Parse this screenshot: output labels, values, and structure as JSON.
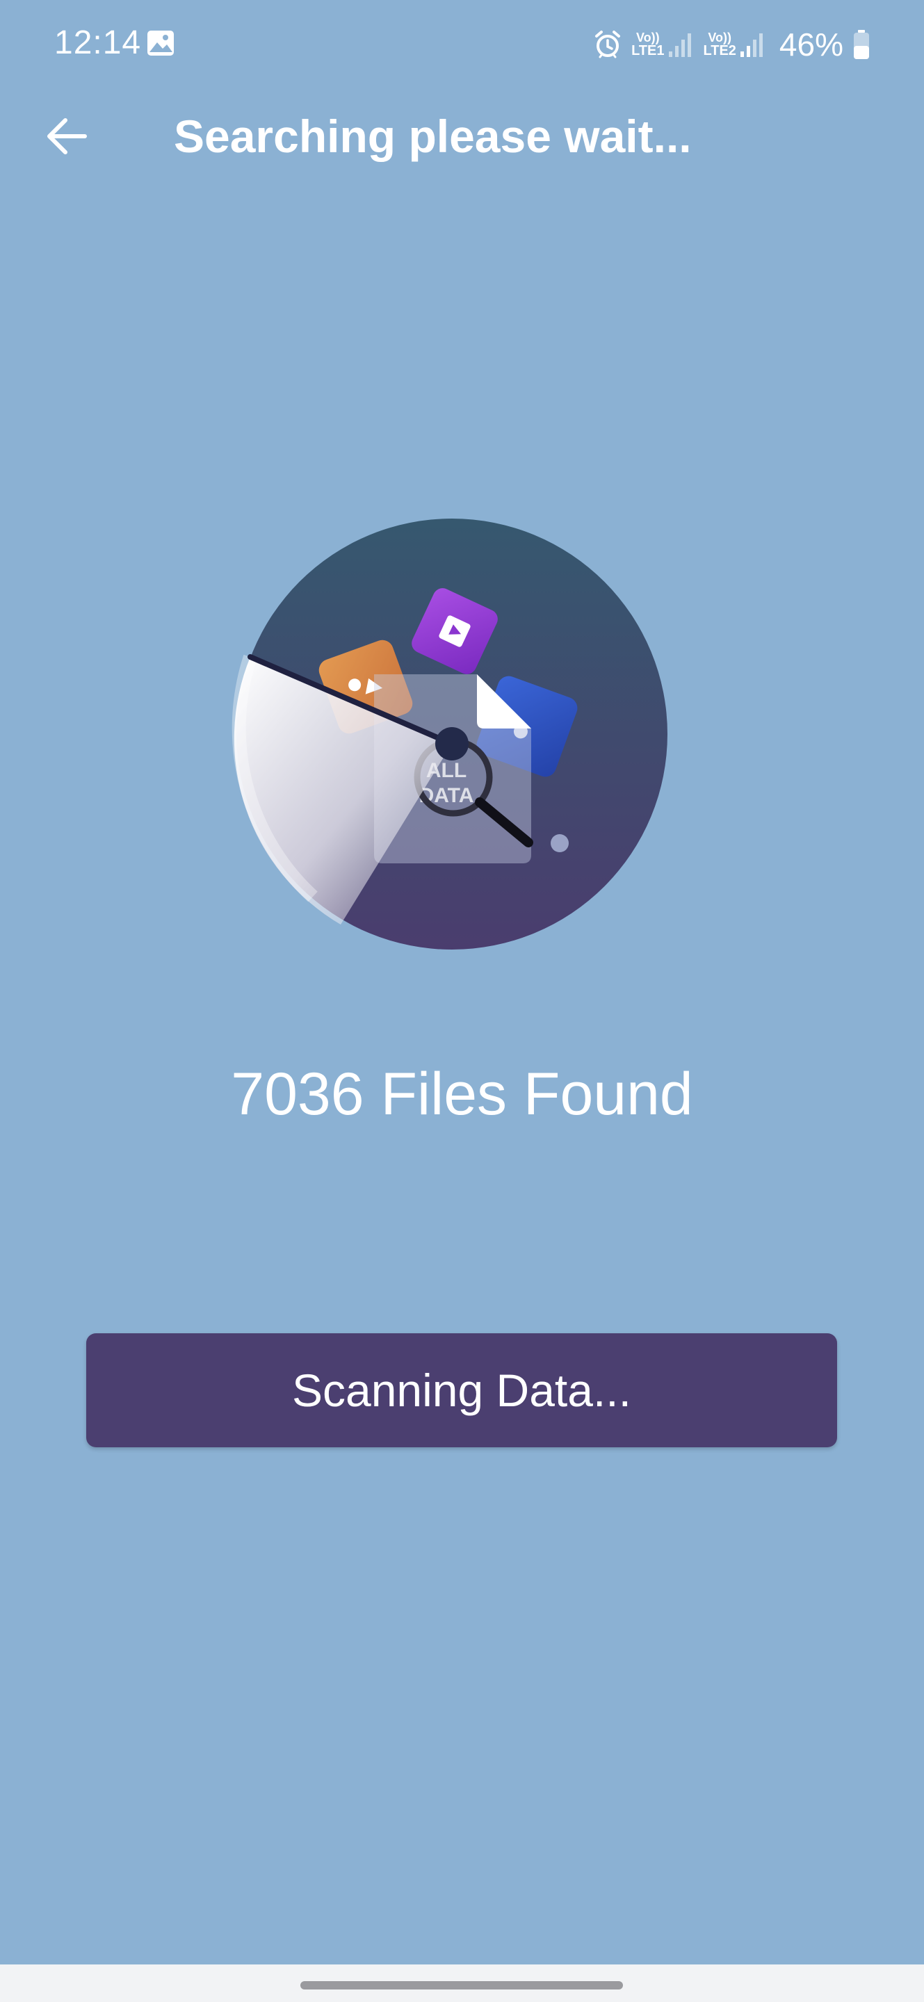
{
  "status_bar": {
    "time": "12:14",
    "sim1_top": "Vo))",
    "sim1_bottom": "LTE1",
    "sim2_top": "Vo))",
    "sim2_bottom": "LTE2",
    "battery": "46%"
  },
  "header": {
    "title": "Searching please wait..."
  },
  "illustration": {
    "doc_label_line1": "ALL",
    "doc_label_line2": "DATA"
  },
  "main": {
    "files_found": "7036 Files Found",
    "scan_button_label": "Scanning Data..."
  },
  "colors": {
    "background": "#8bb1d3",
    "button": "#4b3f70",
    "circle_top": "#36586f",
    "circle_bottom": "#4a3d6e"
  }
}
